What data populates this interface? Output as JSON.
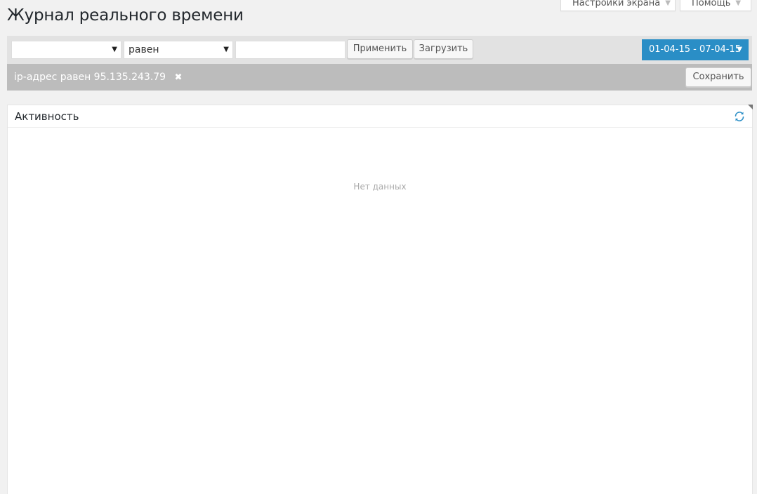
{
  "screen_meta": {
    "screen_options_label": "Настройки экрана",
    "help_label": "Помощь"
  },
  "page_title": "Журнал реального времени",
  "filter_bar": {
    "field_select_value": "",
    "operator_select_value": "равен",
    "value_input_value": "",
    "apply_label": "Применить",
    "load_label": "Загрузить",
    "date_range": "01-04-15 - 07-04-15"
  },
  "active_filter": {
    "text": "ip-адрес равен 95.135.243.79",
    "save_label": "Сохранить"
  },
  "activity_panel": {
    "title": "Активность",
    "empty_text": "Нет данных"
  },
  "colors": {
    "accent": "#2a8ec6",
    "filter_tag_bg": "#bcbcbc"
  }
}
